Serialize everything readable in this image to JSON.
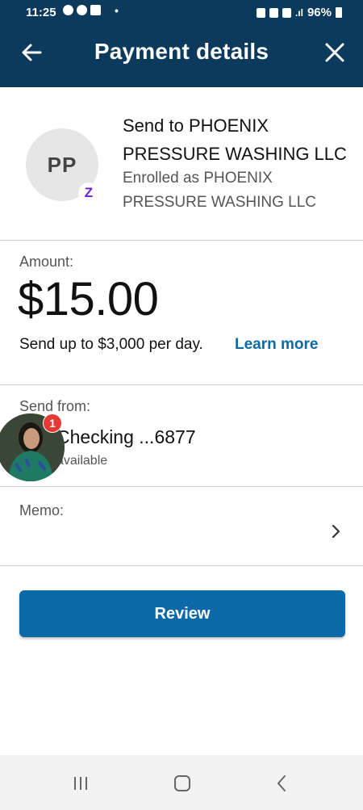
{
  "status_bar": {
    "time": "11:25",
    "battery": "96%"
  },
  "header": {
    "title": "Payment details"
  },
  "recipient": {
    "initials": "PP",
    "send_to": "Send to PHOENIX PRESSURE WASHING LLC",
    "enrolled_as": "Enrolled as PHOENIX PRESSURE WASHING LLC"
  },
  "amount": {
    "label": "Amount:",
    "value": "$15.00",
    "limit_text": "Send up to $3,000 per day.",
    "learn_more": "Learn more"
  },
  "send_from": {
    "label": "Send from:",
    "account": "Checking ...6877",
    "available": "available"
  },
  "chat_head": {
    "badge_count": "1"
  },
  "memo": {
    "label": "Memo:"
  },
  "actions": {
    "review_label": "Review"
  },
  "colors": {
    "header_bg": "#0b3a5c",
    "primary_button": "#0a6aa8",
    "link": "#0b6aa6",
    "zelle_purple": "#6d1ed4",
    "badge_red": "#e53935"
  }
}
